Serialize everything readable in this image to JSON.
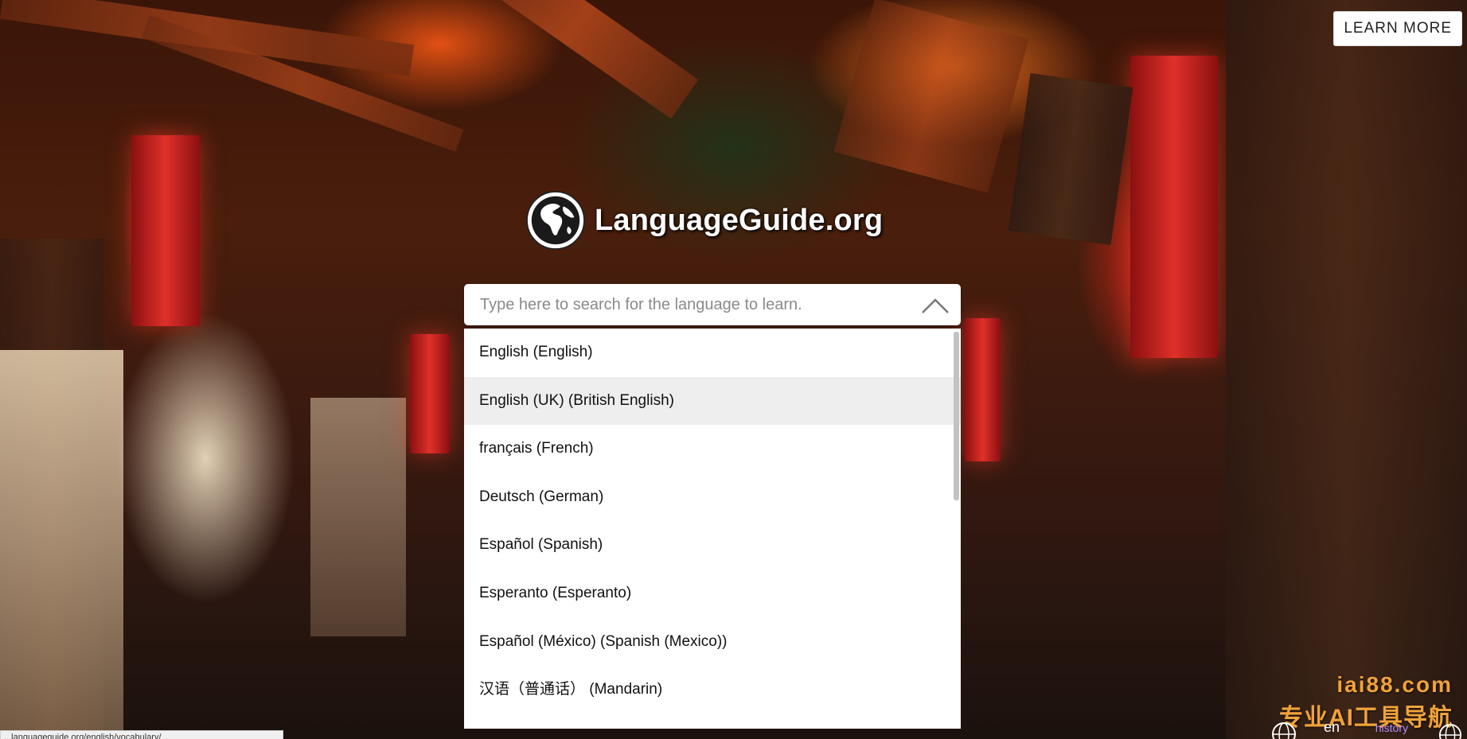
{
  "header": {
    "learn_more_label": "LEARN MORE"
  },
  "logo": {
    "text": "LanguageGuide.org",
    "icon": "globe-icon"
  },
  "search": {
    "placeholder": "Type here to search for the language to learn.",
    "value": "",
    "toggle_icon": "chevron-up-icon"
  },
  "dropdown": {
    "options": [
      {
        "label": "English (English)"
      },
      {
        "label": "English (UK) (British English)"
      },
      {
        "label": "français (French)"
      },
      {
        "label": "Deutsch (German)"
      },
      {
        "label": "Español (Spanish)"
      },
      {
        "label": "Esperanto (Esperanto)"
      },
      {
        "label": "Español (México) (Spanish (Mexico))"
      },
      {
        "label": "汉语（普通话） (Mandarin)"
      }
    ],
    "highlighted_index": 1
  },
  "status_bar": {
    "text": "...languageguide.org/english/vocabulary/..."
  },
  "footer": {
    "language_code": "en",
    "link_text": "history",
    "icon": "globe-icon"
  },
  "watermark": {
    "line1": "iai88.com",
    "line2": "专业AI工具导航"
  },
  "colors": {
    "highlight_bg": "#eeeeee",
    "watermark": "#f0a23a",
    "link": "#b48cff"
  }
}
